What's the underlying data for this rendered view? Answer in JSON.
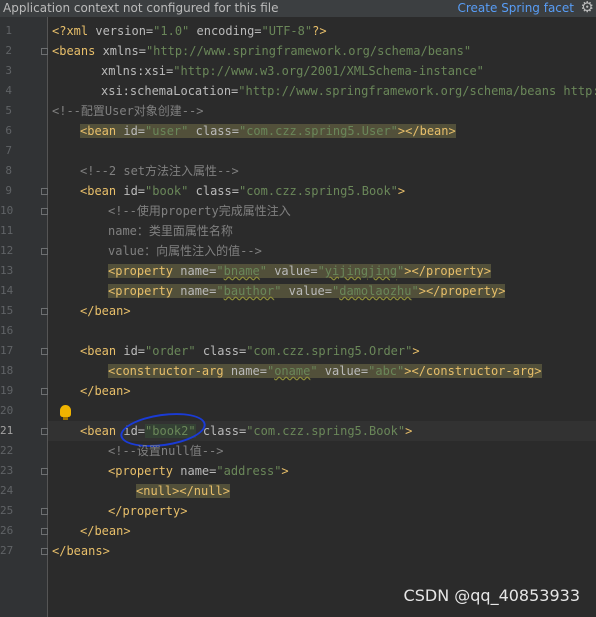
{
  "banner": {
    "message": "Application context not configured for this file",
    "action": "Create Spring facet",
    "settings_icon": "gear-icon"
  },
  "editor": {
    "current_line": 21,
    "line_numbers": [
      "1",
      "2",
      "3",
      "4",
      "5",
      "6",
      "7",
      "8",
      "9",
      "10",
      "11",
      "12",
      "13",
      "14",
      "15",
      "16",
      "17",
      "18",
      "19",
      "20",
      "21",
      "22",
      "23",
      "24",
      "25",
      "26",
      "27"
    ],
    "xml_decl": {
      "open": "<?xml",
      "version_attr": " version=",
      "version_val": "\"1.0\"",
      "encoding_attr": " encoding=",
      "encoding_val": "\"UTF-8\"",
      "close": "?>"
    },
    "beans_open": {
      "tag": "<beans",
      "xmlns_attr": " xmlns=",
      "xmlns_val": "\"http://www.springframework.org/schema/beans\"",
      "xsi_attr": "xmlns:xsi=",
      "xsi_val": "\"http://www.w3.org/2001/XMLSchema-instance\"",
      "loc_attr": "xsi:schemaLocation=",
      "loc_val": "\"http://www.springframework.org/schema/beans http://"
    },
    "comment_user": "<!--配置User对象创建-->",
    "bean_user": {
      "open": "<bean",
      "id_attr": " id=",
      "id_val": "\"user\"",
      "class_attr": " class=",
      "class_val": "\"com.czz.spring5.User\"",
      "end": "></bean>"
    },
    "comment_set": "<!--2 set方法注入属性-->",
    "bean_book": {
      "open": "<bean",
      "id_attr": " id=",
      "id_val": "\"book\"",
      "class_attr": " class=",
      "class_val": "\"com.czz.spring5.Book\"",
      "end": ">"
    },
    "comment_prop_1": "<!--使用property完成属性注入",
    "comment_prop_2": "name：类里面属性名称",
    "comment_prop_3": "value：向属性注入的值-->",
    "prop_bname": {
      "open": "<property",
      "name_attr": " name=",
      "name_q1": "\"",
      "name_val": "bname",
      "name_q2": "\"",
      "value_attr": " value=",
      "value_q1": "\"",
      "value_val": "yijingjing",
      "value_q2": "\"",
      "end": "></property>"
    },
    "prop_bauthor": {
      "open": "<property",
      "name_attr": " name=",
      "name_q1": "\"",
      "name_val": "bauthor",
      "name_q2": "\"",
      "value_attr": " value=",
      "value_q1": "\"",
      "value_val": "damolaozhu",
      "value_q2": "\"",
      "end": "></property>"
    },
    "bean_close": "</bean>",
    "bean_order": {
      "open": "<bean",
      "id_attr": " id=",
      "id_val": "\"order\"",
      "class_attr": " class=",
      "class_val": "\"com.czz.spring5.Order\"",
      "end": ">"
    },
    "ctor_arg": {
      "open": "<constructor-arg",
      "name_attr": " name=",
      "name_q1": "\"",
      "name_val": "oname",
      "name_q2": "\"",
      "value_attr": " value=",
      "value_val": "\"abc\"",
      "end": "></constructor-arg>"
    },
    "bean_book2": {
      "open": "<bean",
      "id_attr": " id=",
      "id_val": "\"book2\"",
      "class_attr": " class=",
      "class_val": "\"com.czz.spring5.Book\"",
      "end": ">"
    },
    "comment_null": "<!--设置null值-->",
    "prop_address": {
      "open": "<property",
      "name_attr": " name=",
      "name_val": "\"address\"",
      "end": ">"
    },
    "null_tag": "<null></null>",
    "prop_close": "</property>",
    "beans_close": "</beans>"
  },
  "intention_icon": "lightbulb-icon",
  "watermark": "CSDN @qq_40853933"
}
